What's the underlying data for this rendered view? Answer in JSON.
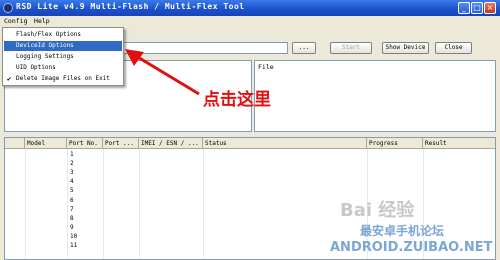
{
  "window": {
    "title": "RSD Lite v4.9 Multi-Flash / Multi-Flex Tool",
    "controls": {
      "minimize": "_",
      "maximize": "□",
      "close": "×"
    }
  },
  "menubar": {
    "items": [
      {
        "label": "Config"
      },
      {
        "label": "Help"
      }
    ]
  },
  "config_menu": {
    "items": [
      {
        "label": "Flash/Flex Options",
        "checked": false,
        "selected": false
      },
      {
        "label": "DeviceId Options",
        "checked": false,
        "selected": true
      },
      {
        "label": "Logging Settings",
        "checked": false,
        "selected": false
      },
      {
        "label": "UID Options",
        "checked": false,
        "selected": false
      },
      {
        "label": "Delete Image Files on Exit",
        "checked": true,
        "selected": false
      }
    ],
    "check_glyph": "✔"
  },
  "toolbar": {
    "browse_label": "...",
    "start_label": "Start",
    "show_device_label": "Show Device",
    "close_label": "Close"
  },
  "file_panel": {
    "label": "File"
  },
  "annotation": {
    "text": "点击这里",
    "color": "#e01010"
  },
  "device_grid": {
    "columns": [
      "Model",
      "Port No.",
      "Port ...",
      "IMEI / ESN / ...",
      "Status",
      "Progress",
      "Result"
    ],
    "rows": [
      "1",
      "2",
      "3",
      "4",
      "5",
      "6",
      "7",
      "8",
      "9",
      "10",
      "11"
    ]
  },
  "watermarks": {
    "baidu": "Bai 经验",
    "site_cn": "最安卓手机论坛",
    "site_url": "ANDROID.ZUIBAO.NET"
  }
}
